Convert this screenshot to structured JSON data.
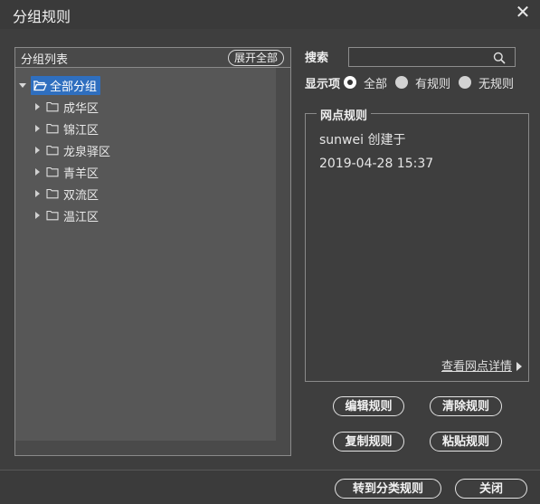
{
  "window": {
    "title": "分组规则"
  },
  "group_panel": {
    "title": "分组列表",
    "expand_all_label": "展开全部",
    "root": {
      "label": "全部分组",
      "expanded": true,
      "selected": true
    },
    "children": [
      {
        "label": "成华区"
      },
      {
        "label": "锦江区"
      },
      {
        "label": "龙泉驿区"
      },
      {
        "label": "青羊区"
      },
      {
        "label": "双流区"
      },
      {
        "label": "温江区"
      }
    ]
  },
  "search": {
    "label": "搜索",
    "value": "",
    "placeholder": ""
  },
  "display": {
    "label": "显示项",
    "options": [
      {
        "label": "全部",
        "checked": true
      },
      {
        "label": "有规则",
        "checked": false
      },
      {
        "label": "无规则",
        "checked": false
      }
    ]
  },
  "rule_panel": {
    "legend": "网点规则",
    "creator_text": "sunwei 创建于",
    "created_time": "2019-04-28 15:37",
    "detail_link": "查看网点详情"
  },
  "actions": {
    "edit": "编辑规则",
    "clear": "清除规则",
    "copy": "复制规则",
    "paste": "粘贴规则"
  },
  "footer": {
    "to_class_rule": "转到分类规则",
    "close": "关闭"
  },
  "colors": {
    "selection": "#2f6fbf",
    "dialog_bg": "#3e3e3e",
    "panel_bg": "#575757"
  }
}
